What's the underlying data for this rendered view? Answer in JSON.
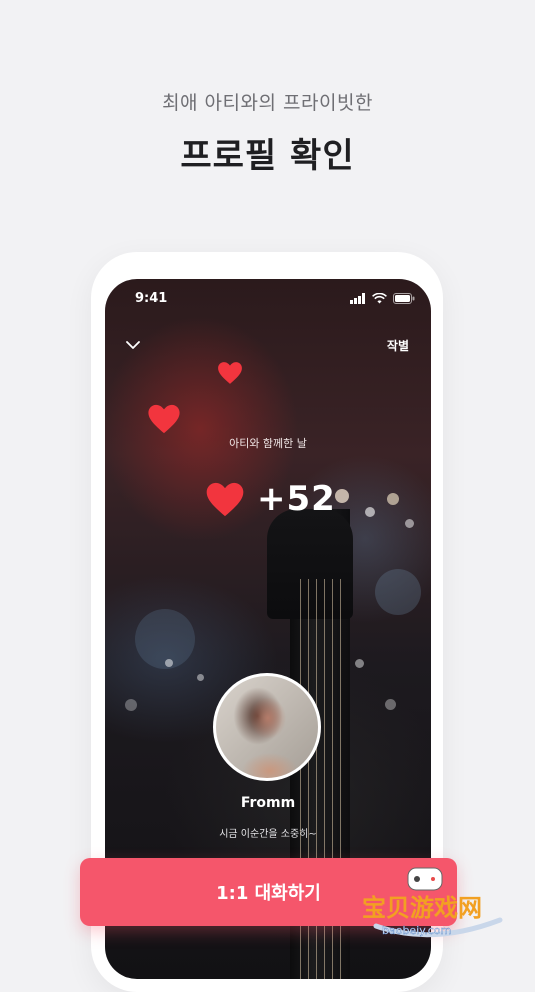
{
  "header": {
    "subtitle": "최애 아티와의 프라이빗한",
    "title": "프로필 확인"
  },
  "status_bar": {
    "time": "9:41",
    "icons": [
      "signal-icon",
      "wifi-icon",
      "battery-icon"
    ]
  },
  "top_nav": {
    "back_icon": "chevron-down-icon",
    "farewell_label": "작별"
  },
  "together": {
    "label": "아티와 함께한 날",
    "heart_icon": "heart-icon",
    "count": "+52"
  },
  "profile": {
    "name": "Fromm",
    "status": "시금 이순간을 소중히~"
  },
  "cta": {
    "label": "1:1 대화하기"
  },
  "watermark": {
    "text": "宝贝游戏网",
    "url": "baobeiy.com"
  },
  "colors": {
    "accent": "#f5566b",
    "heart": "#f2353e",
    "background": "#f2f2f4"
  }
}
